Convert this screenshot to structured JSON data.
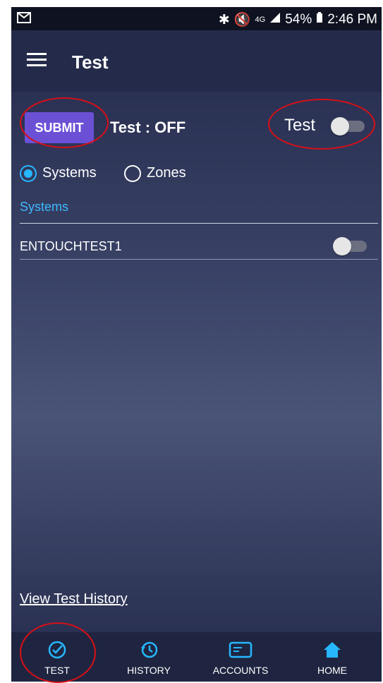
{
  "statusbar": {
    "battery": "54%",
    "time": "2:46 PM",
    "network": "4G"
  },
  "appbar": {
    "title": "Test"
  },
  "controls": {
    "submit_label": "SUBMIT",
    "test_status": "Test : OFF",
    "toggle_label": "Test"
  },
  "radios": {
    "systems_label": "Systems",
    "zones_label": "Zones",
    "selected": "Systems"
  },
  "list": {
    "section_title": "Systems",
    "items": [
      {
        "label": "ENTOUCHTEST1",
        "toggle": "off"
      }
    ]
  },
  "history_link": "View Test History",
  "bottomnav": {
    "items": [
      {
        "label": "TEST",
        "icon": "check-circle-icon"
      },
      {
        "label": "HISTORY",
        "icon": "history-icon"
      },
      {
        "label": "ACCOUNTS",
        "icon": "card-icon"
      },
      {
        "label": "HOME",
        "icon": "home-icon"
      }
    ]
  },
  "colors": {
    "accent": "#26b7ff",
    "submit": "#6b50d6",
    "annotation": "#d90f16"
  }
}
